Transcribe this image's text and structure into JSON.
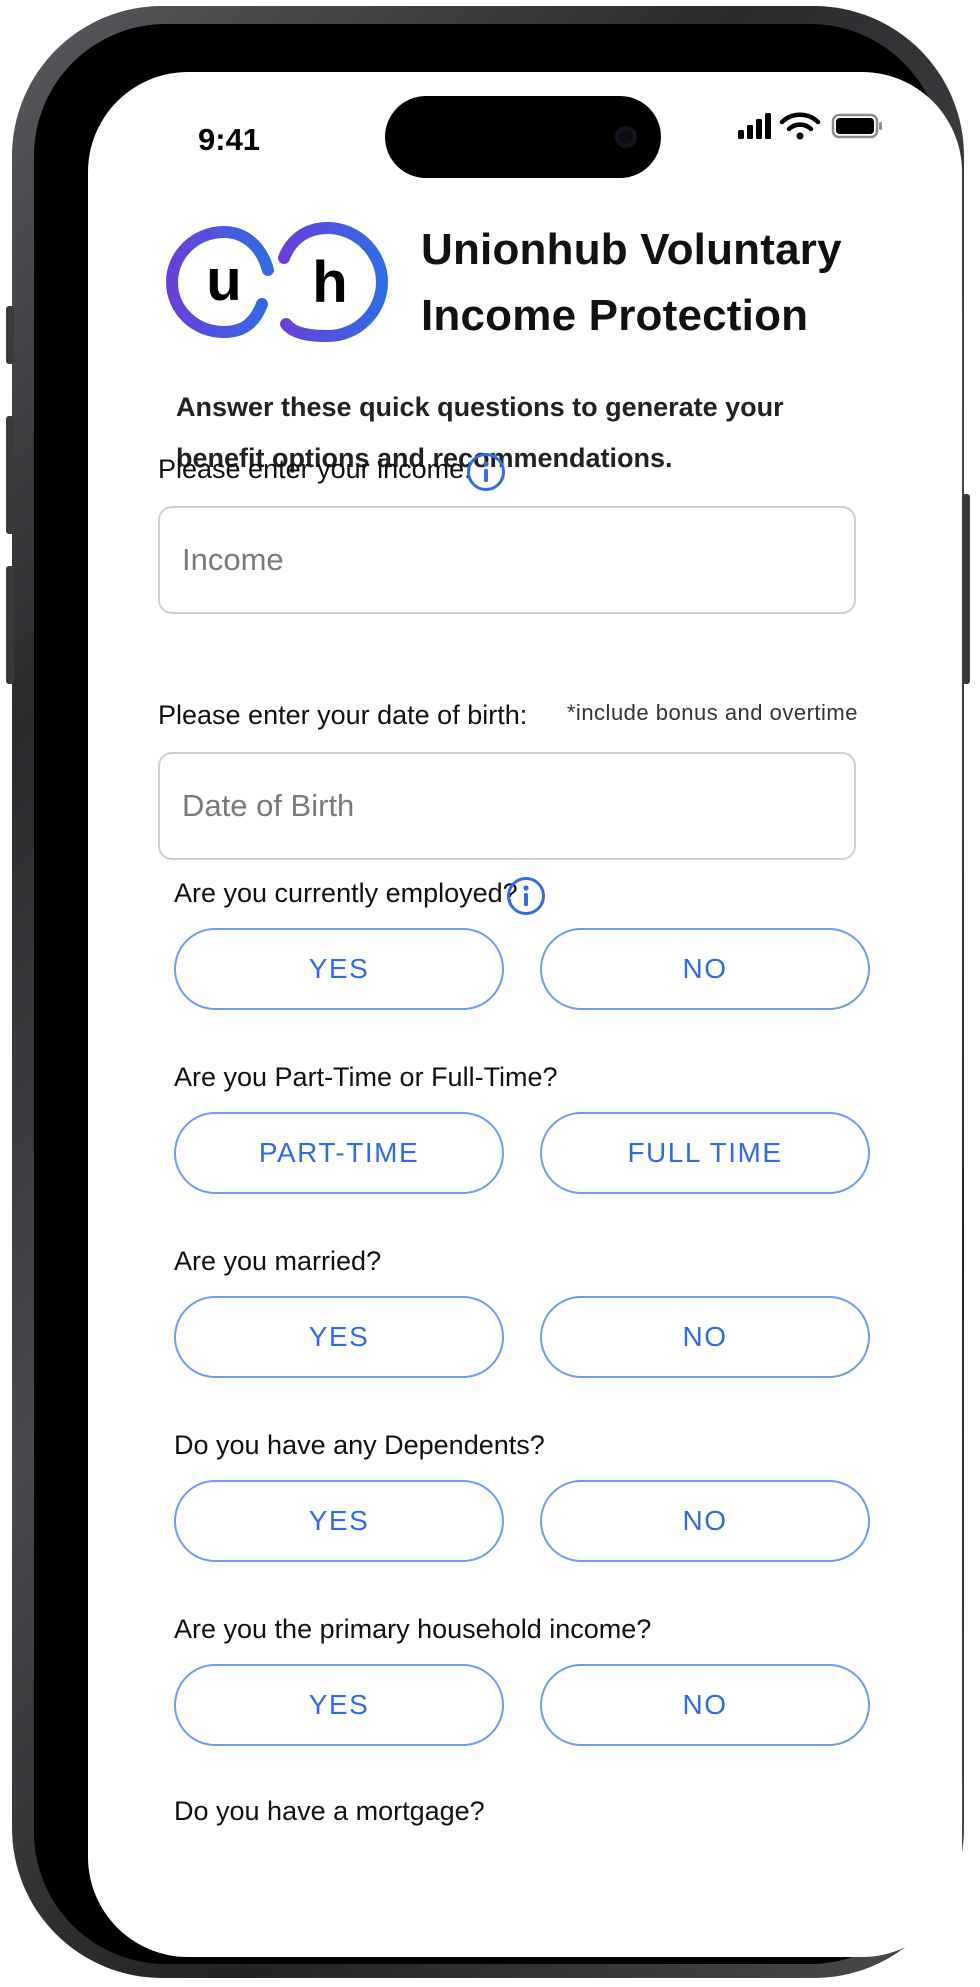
{
  "status_bar": {
    "time": "9:41"
  },
  "app": {
    "title_line1": "Unionhub Voluntary",
    "title_line2": "Income Protection",
    "logo_letter1": "u",
    "logo_letter2": "h"
  },
  "intro": {
    "text": "Answer these quick questions to generate your benefit options and recommendations."
  },
  "income": {
    "label": "Please enter your income:",
    "placeholder": "Income",
    "hint": "*include bonus and overtime"
  },
  "dob": {
    "label": "Please enter your date of birth:",
    "placeholder": "Date of Birth"
  },
  "questions": [
    {
      "label": "Are you currently employed?",
      "option_a": "YES",
      "option_b": "NO"
    },
    {
      "label": "Are you Part-Time or Full-Time?",
      "option_a": "PART-TIME",
      "option_b": "FULL TIME"
    },
    {
      "label": "Are you married?",
      "option_a": "YES",
      "option_b": "NO"
    },
    {
      "label": "Do you have any Dependents?",
      "option_a": "YES",
      "option_b": "NO"
    },
    {
      "label": "Are you the primary household income?",
      "option_a": "YES",
      "option_b": "NO"
    },
    {
      "label": "Do you have a mortgage?"
    }
  ],
  "colors": {
    "accent": "#2f6ce5",
    "pill_border": "#6e9bf4",
    "logo_gradient_start": "#6a3fd8",
    "logo_gradient_end": "#2f6ce5"
  },
  "icons": {
    "info": "info-circle-icon",
    "signal": "cellular-signal-icon",
    "wifi": "wifi-icon",
    "battery": "battery-icon"
  }
}
